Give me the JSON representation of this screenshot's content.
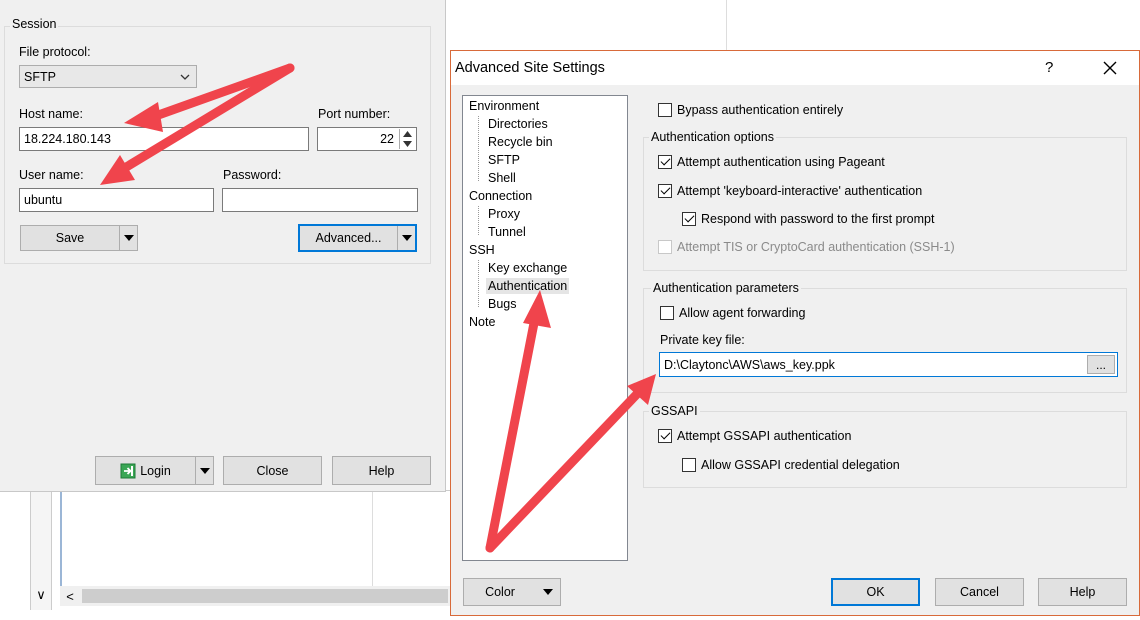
{
  "session": {
    "group_label": "Session",
    "file_protocol_label": "File protocol:",
    "file_protocol_value": "SFTP",
    "host_name_label": "Host name:",
    "host_name_value": "18.224.180.143",
    "port_label": "Port number:",
    "port_value": "22",
    "user_name_label": "User name:",
    "user_name_value": "ubuntu",
    "password_label": "Password:",
    "password_value": "",
    "save_label": "Save",
    "advanced_label": "Advanced...",
    "login_label": "Login",
    "close_label": "Close",
    "help_label": "Help"
  },
  "dialog": {
    "title": "Advanced Site Settings",
    "help_glyph": "?",
    "close_glyph": "✕",
    "tree": [
      {
        "label": "Environment",
        "level": 0
      },
      {
        "label": "Directories",
        "level": 1
      },
      {
        "label": "Recycle bin",
        "level": 1
      },
      {
        "label": "SFTP",
        "level": 1
      },
      {
        "label": "Shell",
        "level": 1
      },
      {
        "label": "Connection",
        "level": 0
      },
      {
        "label": "Proxy",
        "level": 1
      },
      {
        "label": "Tunnel",
        "level": 1
      },
      {
        "label": "SSH",
        "level": 0
      },
      {
        "label": "Key exchange",
        "level": 1
      },
      {
        "label": "Authentication",
        "level": 1,
        "selected": true
      },
      {
        "label": "Bugs",
        "level": 1
      },
      {
        "label": "Note",
        "level": 0
      }
    ],
    "bypass_label": "Bypass authentication entirely",
    "auth_options_legend": "Authentication options",
    "pageant_label": "Attempt authentication using Pageant",
    "kbd_label": "Attempt 'keyboard-interactive' authentication",
    "respond_label": "Respond with password to the first prompt",
    "tis_label": "Attempt TIS or CryptoCard authentication (SSH-1)",
    "auth_params_legend": "Authentication parameters",
    "agent_fwd_label": "Allow agent forwarding",
    "private_key_label": "Private key file:",
    "private_key_value": "D:\\Claytonc\\AWS\\aws_key.ppk",
    "browse_label": "...",
    "gssapi_legend": "GSSAPI",
    "gssapi_attempt_label": "Attempt GSSAPI authentication",
    "gssapi_deleg_label": "Allow GSSAPI credential delegation",
    "color_label": "Color",
    "ok_label": "OK",
    "cancel_label": "Cancel",
    "help_label": "Help"
  },
  "background": {
    "scroll_down_glyph": "∨",
    "scroll_left_glyph": "<"
  },
  "colors": {
    "accent": "#0078d7",
    "annotation_arrow": "#f0444c",
    "selected_bg": "#e5e5e5"
  }
}
